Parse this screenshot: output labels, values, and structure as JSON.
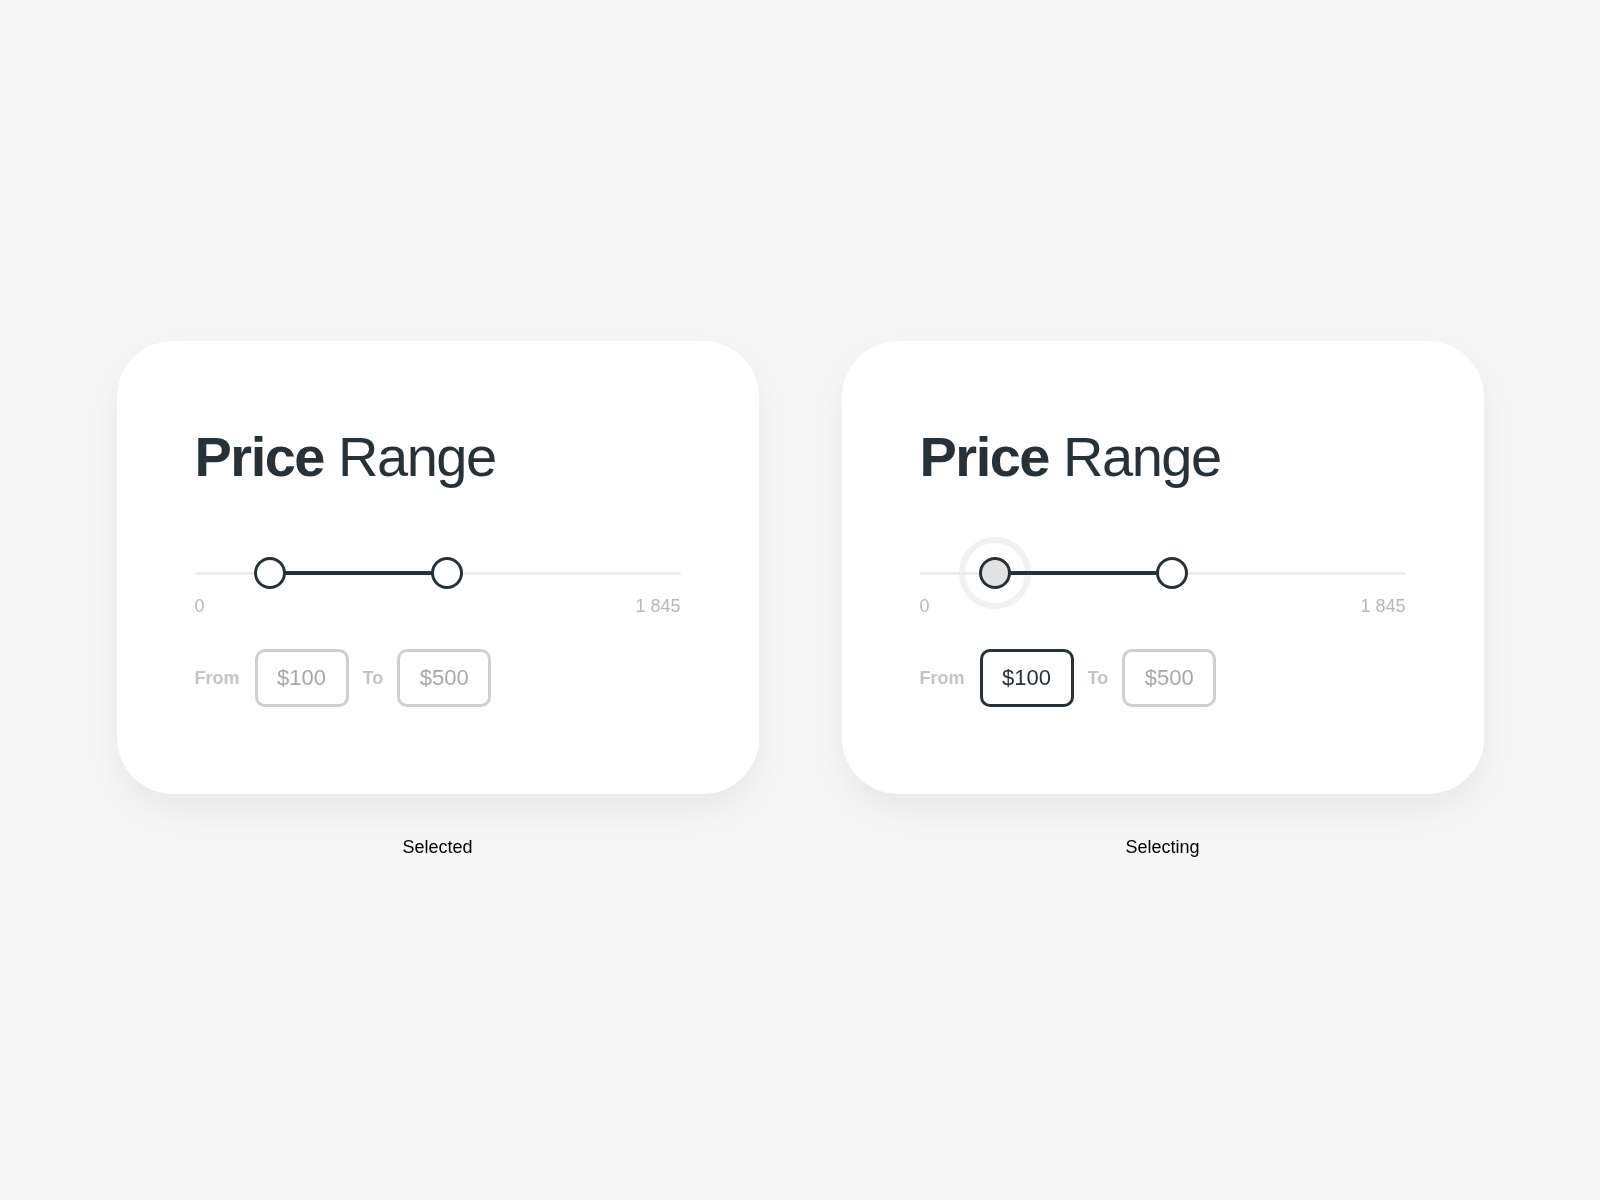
{
  "cards": [
    {
      "title": "**Price** Range",
      "min_label": "0",
      "max_label": "1 845",
      "thumbs": [
        {
          "level": 0.156,
          "active": false
        },
        {
          "level": 0.52,
          "active": false
        }
      ],
      "fields": [
        {
          "label": "From",
          "value": "$100",
          "focused": false
        },
        {
          "label": "To",
          "value": "$500",
          "focused": false
        }
      ],
      "caption": "Selected"
    },
    {
      "title": "**Price** Range",
      "min_label": "0",
      "max_label": "1 845",
      "thumbs": [
        {
          "level": 0.156,
          "active": true
        },
        {
          "level": 0.52,
          "active": false
        }
      ],
      "fields": [
        {
          "label": "From",
          "value": "$100",
          "focused": true
        },
        {
          "label": "To",
          "value": "$500",
          "focused": false
        }
      ],
      "caption": "Selecting"
    }
  ]
}
